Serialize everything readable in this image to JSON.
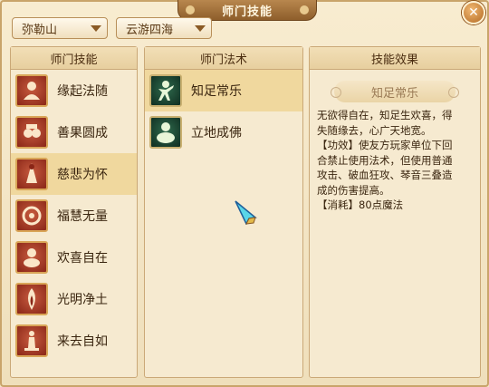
{
  "window": {
    "title": "师门技能",
    "close_icon": "close-icon"
  },
  "filters": {
    "sect": "弥勒山",
    "region": "云游四海"
  },
  "columns": {
    "skills_header": "师门技能",
    "spells_header": "师门法术",
    "effect_header": "技能效果"
  },
  "skills": [
    {
      "label": "缘起法随",
      "icon": "meditation-icon"
    },
    {
      "label": "善果圆成",
      "icon": "fruit-icon"
    },
    {
      "label": "慈悲为怀",
      "icon": "statue-icon"
    },
    {
      "label": "福慧无量",
      "icon": "flower-icon"
    },
    {
      "label": "欢喜自在",
      "icon": "buddha-icon"
    },
    {
      "label": "光明净土",
      "icon": "flame-icon"
    },
    {
      "label": "来去自如",
      "icon": "lamp-icon"
    }
  ],
  "selected_skill_index": 2,
  "spells": [
    {
      "label": "知足常乐",
      "icon": "dancing-figure-icon"
    },
    {
      "label": "立地成佛",
      "icon": "seated-buddha-icon"
    }
  ],
  "selected_spell_index": 0,
  "effect": {
    "name": "知足常乐",
    "lines": [
      "无欲得自在，知足生欢喜，得",
      "失随缘去，心广天地宽。",
      "【功效】使友方玩家单位下回",
      "合禁止使用法术，但使用普通",
      "攻击、破血狂攻、琴音三叠造",
      "成的伤害提高。",
      "【消耗】80点魔法"
    ]
  },
  "colors": {
    "accent": "#8e5e2b",
    "selected_row": "#f0d89e",
    "panel_bg": "#f6ead0"
  }
}
